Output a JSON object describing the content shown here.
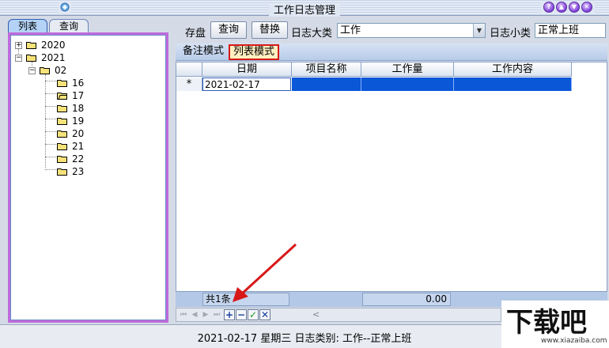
{
  "window": {
    "title": "工作日志管理"
  },
  "left_tabs": [
    {
      "label": "列表",
      "active": true
    },
    {
      "label": "查询",
      "active": false
    }
  ],
  "tree": {
    "nodes": [
      {
        "label": "2020",
        "expander": "+"
      },
      {
        "label": "2021",
        "expander": "−"
      },
      {
        "label": "02",
        "expander": "−"
      },
      {
        "label": "16"
      },
      {
        "label": "17",
        "open": true
      },
      {
        "label": "18"
      },
      {
        "label": "19"
      },
      {
        "label": "20"
      },
      {
        "label": "21"
      },
      {
        "label": "22"
      },
      {
        "label": "23"
      }
    ]
  },
  "toolbar": {
    "save_label": "存盘",
    "query_label": "查询",
    "replace_label": "替换",
    "category_label": "日志大类",
    "category_value": "工作",
    "subcategory_label": "日志小类",
    "subcategory_value": "正常上班"
  },
  "mode_tabs": {
    "note": "备注模式",
    "list": "列表模式"
  },
  "grid": {
    "columns": [
      "日期",
      "项目名称",
      "工作量",
      "工作内容"
    ],
    "row_marker": "*",
    "rows": [
      {
        "date": "2021-02-17",
        "project": "",
        "workload": "",
        "content": ""
      }
    ]
  },
  "footer": {
    "count": "共1条",
    "sum": "0.00"
  },
  "nav": {
    "first": "⏮",
    "prev": "◀",
    "next": "▶",
    "last": "⏭",
    "add": "+",
    "remove": "−",
    "confirm": "✓",
    "cancel": "✕",
    "scroll_left": "<"
  },
  "status": {
    "text": "2021-02-17 星期三 日志类别: 工作--正常上班"
  },
  "watermark": {
    "logo": "下载吧",
    "url": "www.xiazaiba.com"
  },
  "colors": {
    "selection": "#0a57d8",
    "highlight_border": "#d81818",
    "tree_border": "#c06adc"
  }
}
